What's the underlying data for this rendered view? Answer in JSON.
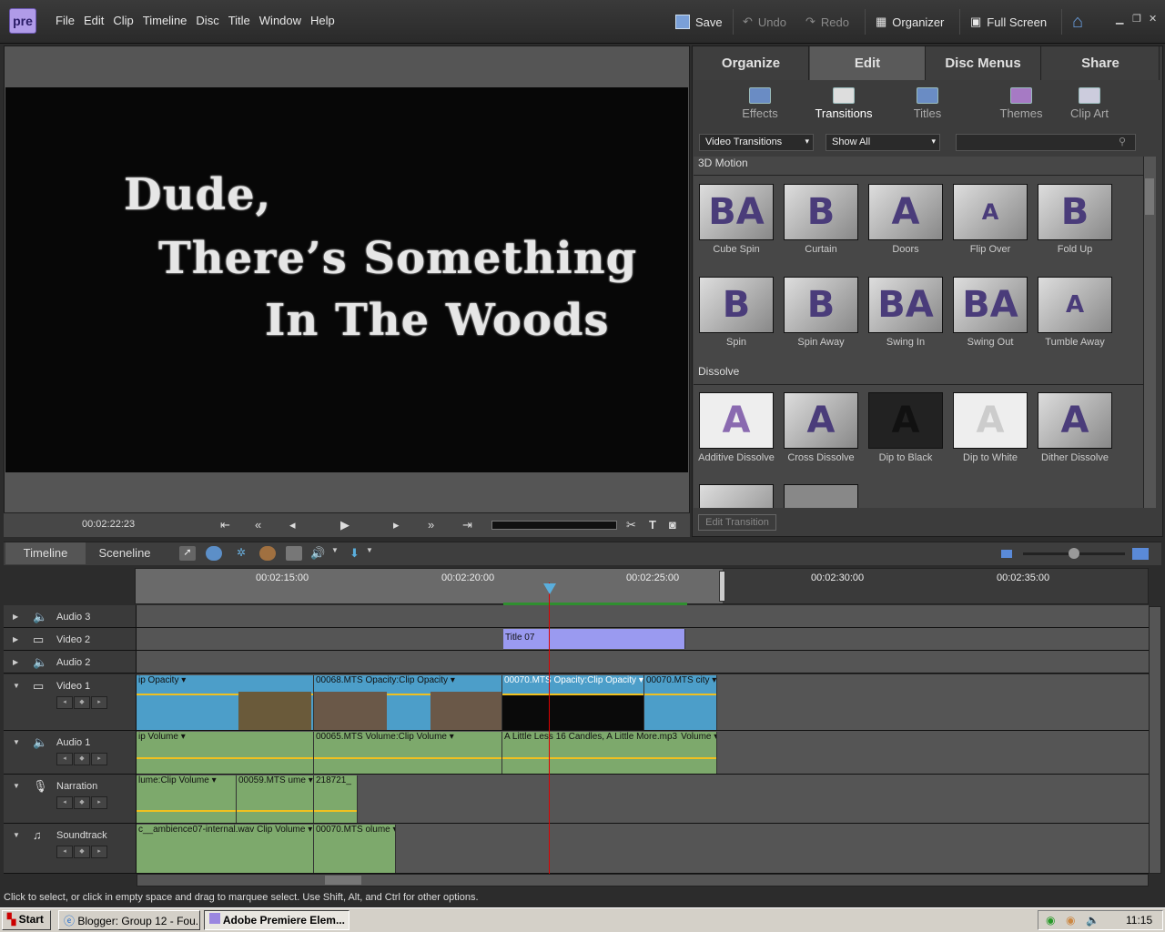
{
  "app": {
    "logo": "pre"
  },
  "menu": [
    "File",
    "Edit",
    "Clip",
    "Timeline",
    "Disc",
    "Title",
    "Window",
    "Help"
  ],
  "toolbar": {
    "save": "Save",
    "undo": "Undo",
    "redo": "Redo",
    "organizer": "Organizer",
    "fullscreen": "Full Screen"
  },
  "monitor": {
    "title_lines": [
      "Dude,",
      "There’s Something",
      "In The Woods"
    ],
    "timecode": "00:02:22:23"
  },
  "panel": {
    "tabs": [
      "Organize",
      "Edit",
      "Disc Menus",
      "Share"
    ],
    "active_tab": "Edit",
    "subtabs": [
      "Effects",
      "Transitions",
      "Titles",
      "Themes",
      "Clip Art"
    ],
    "active_subtab": "Transitions",
    "dropdown1": "Video Transitions",
    "dropdown2": "Show All",
    "categories": [
      {
        "name": "3D Motion",
        "items": [
          "Cube Spin",
          "Curtain",
          "Doors",
          "Flip Over",
          "Fold Up",
          "Spin",
          "Spin Away",
          "Swing In",
          "Swing Out",
          "Tumble Away"
        ]
      },
      {
        "name": "Dissolve",
        "items": [
          "Additive Dissolve",
          "Cross Dissolve",
          "Dip to Black",
          "Dip to White",
          "Dither Dissolve"
        ]
      }
    ],
    "edit_transition": "Edit Transition"
  },
  "timeline": {
    "tabs": [
      "Timeline",
      "Sceneline"
    ],
    "ruler": [
      "00:02:15:00",
      "00:02:20:00",
      "00:02:25:00",
      "00:02:30:00",
      "00:02:35:00"
    ],
    "tracks": [
      "Audio 3",
      "Video 2",
      "Audio 2",
      "Video 1",
      "Audio 1",
      "Narration",
      "Soundtrack"
    ],
    "clips": {
      "title07": "Title 07",
      "v1a": "ip Opacity ▾",
      "v1b": "00068.MTS   Opacity:Clip Opacity ▾",
      "v1c": "00070.MTS   Opacity:Clip Opacity ▾",
      "v1d": "00070.MTS   city ▾",
      "a1a": "ip Volume ▾",
      "a1b": "00065.MTS   Volume:Clip Volume ▾",
      "a1c": "A Little Less 16 Candles, A Little More.mp3",
      "a1d": "Volume ▾",
      "na": "lume:Clip Volume ▾",
      "nb": "00059.MTS   ume ▾",
      "nc": "218721_",
      "sa": "c__ambience07-internal.wav   Clip Volume ▾",
      "sb": "00070.MTS   olume ▾"
    }
  },
  "status": "Click to select, or click in empty space and drag to marquee select. Use Shift, Alt, and Ctrl for other options.",
  "taskbar": {
    "start": "Start",
    "tasks": [
      "Blogger: Group 12 - Fou...",
      "Adobe Premiere Elem..."
    ],
    "clock": "11:15"
  }
}
